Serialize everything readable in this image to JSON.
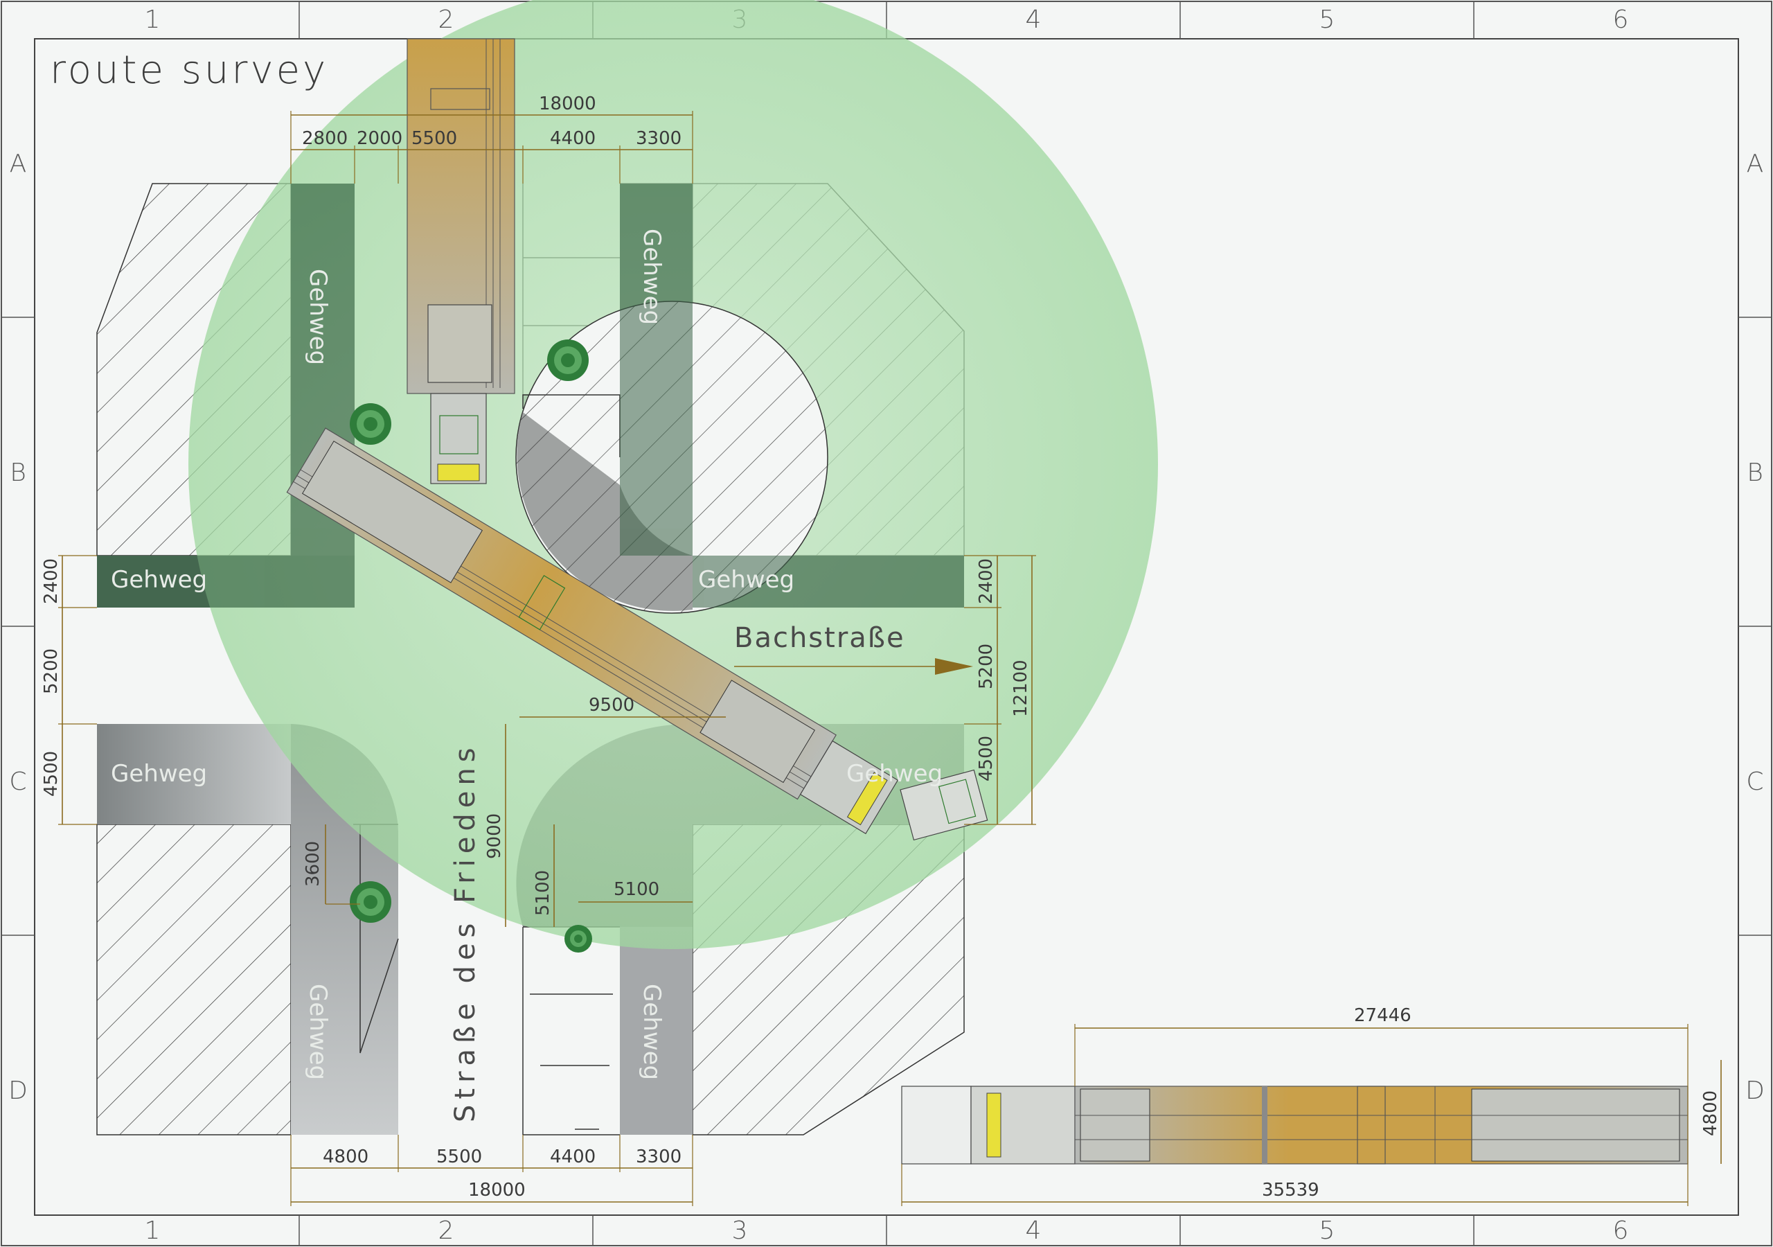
{
  "title": "route survey",
  "grid": {
    "columns": [
      "1",
      "2",
      "3",
      "4",
      "5",
      "6"
    ],
    "rows": [
      "A",
      "B",
      "C",
      "D"
    ]
  },
  "labels": {
    "walkway": "Gehweg",
    "street_horizontal": "Bachstraße",
    "street_vertical": "Straße des Friedens"
  },
  "dimensions": {
    "top_total": "18000",
    "top_1": "2800",
    "top_2": "2000",
    "top_3": "5500",
    "top_4": "4400",
    "top_5": "3300",
    "left_1": "2400",
    "left_2": "5200",
    "left_3": "4500",
    "right_1": "2400",
    "right_2": "5200",
    "right_3": "4500",
    "right_total": "12100",
    "inner_width": "9500",
    "inner_height": "9000",
    "tree_offset_v": "3600",
    "tree_offset_v2": "5100",
    "tree_offset_h": "5100",
    "bottom_1": "4800",
    "bottom_2": "5500",
    "bottom_3": "4400",
    "bottom_4": "3300",
    "bottom_total": "18000",
    "vehicle_trailer_length": "27446",
    "vehicle_total_length": "35539",
    "vehicle_width": "4800"
  },
  "colors": {
    "walkway_dark": "#4e6e58",
    "walkway_grey": "#9a9c9d",
    "swept_circle": "#a8d9a8",
    "trailer_gold": "#c8a14a",
    "dimension": "#8a6b1f",
    "tree": "#2e7d3a"
  }
}
